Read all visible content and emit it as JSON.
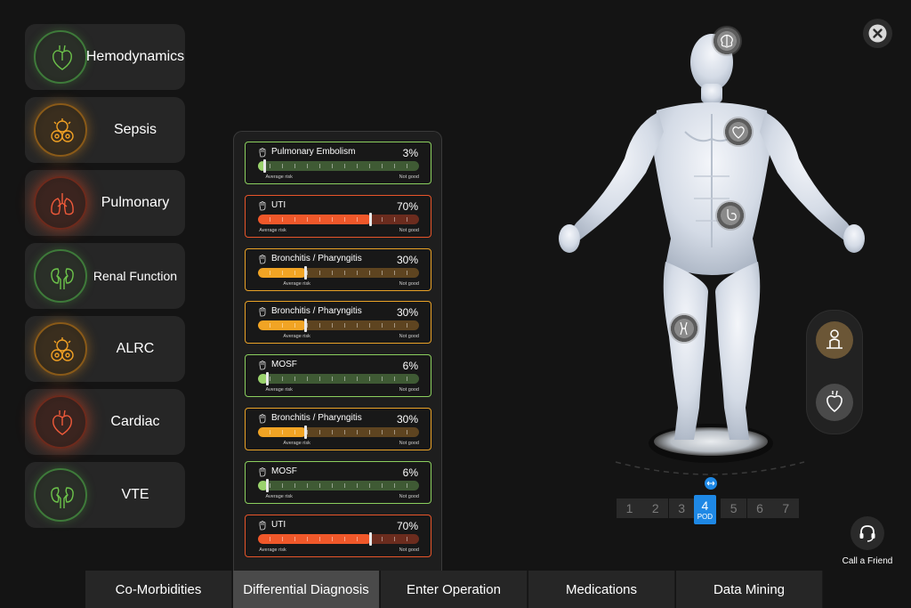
{
  "sidebar": {
    "items": [
      {
        "label": "Hemodynamics",
        "icon": "heart-icon",
        "status": "green"
      },
      {
        "label": "Sepsis",
        "icon": "virus-icon",
        "status": "orange"
      },
      {
        "label": "Pulmonary",
        "icon": "lungs-icon",
        "status": "red"
      },
      {
        "label": "Renal Function",
        "icon": "kidney-icon",
        "status": "green"
      },
      {
        "label": "ALRC",
        "icon": "virus-icon",
        "status": "orange"
      },
      {
        "label": "Cardiac",
        "icon": "heart-icon",
        "status": "red"
      },
      {
        "label": "VTE",
        "icon": "kidney-icon",
        "status": "green"
      }
    ]
  },
  "diagnosis": {
    "items": [
      {
        "name": "Pulmonary Embolism",
        "percent": "3%",
        "level": 0.03,
        "average_risk": 0.08,
        "status": "green",
        "left_label": "Average risk",
        "right_label": "Not good"
      },
      {
        "name": "UTI",
        "percent": "70%",
        "level": 0.7,
        "average_risk": 0.04,
        "status": "red",
        "left_label": "Average risk",
        "right_label": "Not good"
      },
      {
        "name": "Bronchitis / Pharyngitis",
        "percent": "30%",
        "level": 0.3,
        "average_risk": 0.19,
        "status": "orange",
        "left_label": "Average risk",
        "right_label": "Not good"
      },
      {
        "name": "Bronchitis / Pharyngitis",
        "percent": "30%",
        "level": 0.3,
        "average_risk": 0.19,
        "status": "orange",
        "left_label": "Average risk",
        "right_label": "Not good"
      },
      {
        "name": "MOSF",
        "percent": "6%",
        "level": 0.06,
        "average_risk": 0.08,
        "status": "green",
        "left_label": "Average risk",
        "right_label": "Not good"
      },
      {
        "name": "Bronchitis / Pharyngitis",
        "percent": "30%",
        "level": 0.3,
        "average_risk": 0.19,
        "status": "orange",
        "left_label": "Average risk",
        "right_label": "Not good"
      },
      {
        "name": "MOSF",
        "percent": "6%",
        "level": 0.06,
        "average_risk": 0.08,
        "status": "green",
        "left_label": "Average risk",
        "right_label": "Not good"
      },
      {
        "name": "UTI",
        "percent": "70%",
        "level": 0.7,
        "average_risk": 0.04,
        "status": "red",
        "left_label": "Average risk",
        "right_label": "Not good"
      }
    ]
  },
  "tabs": [
    {
      "label": "Co-Morbidities",
      "active": false
    },
    {
      "label": "Differential Diagnosis",
      "active": true
    },
    {
      "label": "Enter Operation",
      "active": false
    },
    {
      "label": "Medications",
      "active": false
    },
    {
      "label": "Data  Mining",
      "active": false
    }
  ],
  "pods": {
    "numbers": [
      "1",
      "2",
      "3",
      "4",
      "5",
      "6",
      "7"
    ],
    "active": "4",
    "active_caption": "POD"
  },
  "call_friend": {
    "label": "Call a Friend",
    "icon": "headset-icon"
  },
  "close": {
    "icon": "close-icon"
  },
  "colors": {
    "green": "#8bcf5e",
    "red": "#e8552a",
    "orange": "#e9a227",
    "accent": "#1e88e5",
    "background": "#141414"
  }
}
